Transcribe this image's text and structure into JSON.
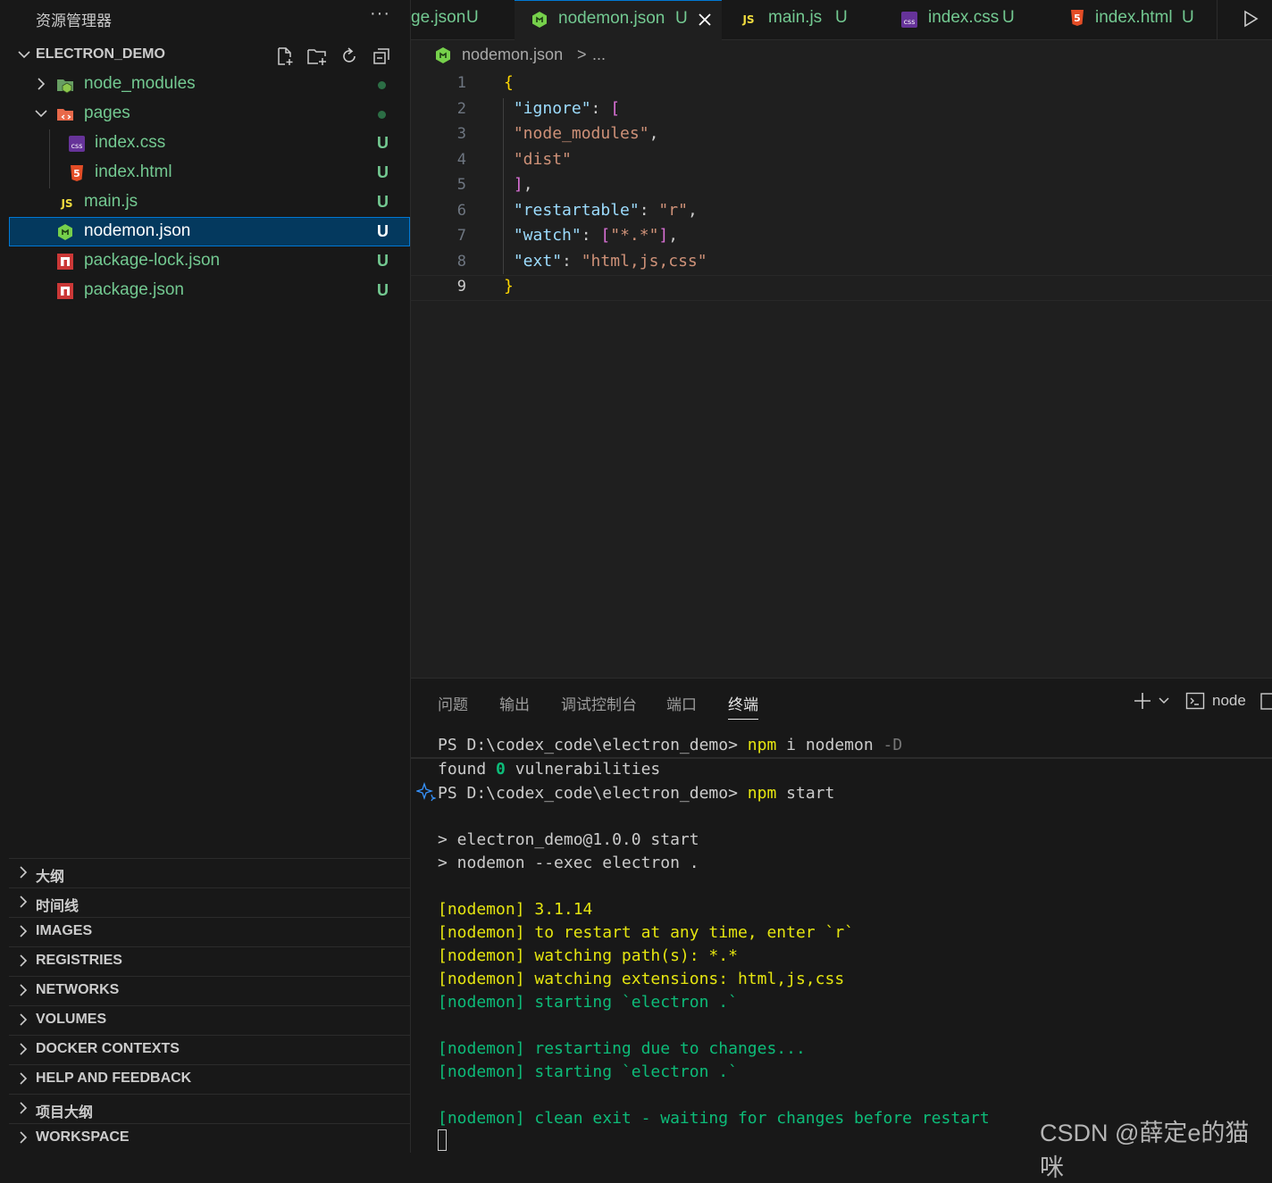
{
  "sidebar": {
    "title": "资源管理器",
    "more": "···",
    "project": "ELECTRON_DEMO",
    "tree": [
      {
        "label": "node_modules",
        "status": "dot"
      },
      {
        "label": "pages",
        "status": "dot"
      },
      {
        "label": "index.css",
        "status": "U"
      },
      {
        "label": "index.html",
        "status": "U"
      },
      {
        "label": "main.js",
        "status": "U"
      },
      {
        "label": "nodemon.json",
        "status": "U"
      },
      {
        "label": "package-lock.json",
        "status": "U"
      },
      {
        "label": "package.json",
        "status": "U"
      }
    ],
    "panels": [
      "大纲",
      "时间线",
      "IMAGES",
      "REGISTRIES",
      "NETWORKS",
      "VOLUMES",
      "DOCKER CONTEXTS",
      "HELP AND FEEDBACK",
      "项目大纲",
      "WORKSPACE"
    ]
  },
  "tabs": [
    {
      "label": "ge.json",
      "status": "U"
    },
    {
      "label": "nodemon.json",
      "status": "U"
    },
    {
      "label": "main.js",
      "status": "U"
    },
    {
      "label": "index.css",
      "status": "U"
    },
    {
      "label": "index.html",
      "status": "U"
    }
  ],
  "breadcrumb": {
    "file": "nodemon.json",
    "sep": ">",
    "rest": "..."
  },
  "editor": {
    "line_numbers": [
      "1",
      "2",
      "3",
      "4",
      "5",
      "6",
      "7",
      "8",
      "9"
    ],
    "current_line": "9"
  },
  "panel": {
    "tabs": [
      "问题",
      "输出",
      "调试控制台",
      "端口",
      "终端"
    ],
    "active_tab": "终端",
    "terminal_name": "node"
  },
  "terminal": {
    "prompt": "PS D:\\codex_code\\electron_demo>",
    "cmd1_bin": "npm",
    "cmd1_args": "i nodemon",
    "cmd1_flag": "-D",
    "found": "found",
    "zero": "0",
    "vuln": "vulnerabilities",
    "cmd2_bin": "npm",
    "cmd2_args": "start",
    "out1": "> electron_demo@1.0.0 start",
    "out2": "> nodemon --exec electron .",
    "nm1": "[nodemon] 3.1.14",
    "nm2": "[nodemon] to restart at any time, enter `r`",
    "nm3": "[nodemon] watching path(s): *.*",
    "nm4": "[nodemon] watching extensions: html,js,css",
    "nm5": "[nodemon] starting `electron .`",
    "nm6": "[nodemon] restarting due to changes...",
    "nm7": "[nodemon] starting `electron .`",
    "nm8": "[nodemon] clean exit - waiting for changes before restart"
  },
  "watermark": "CSDN @薛定e的猫咪",
  "colors": {
    "accent": "#0078d4",
    "untracked": "#73c991",
    "selection": "#04395e"
  }
}
